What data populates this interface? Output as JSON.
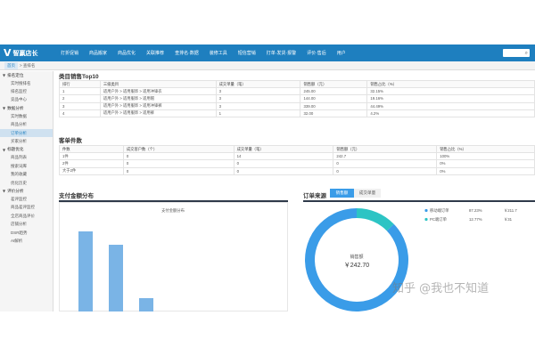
{
  "colors": {
    "topbar": "#1e7fbf",
    "bar": "#7ab4e6",
    "donut_main": "#3a9ce8",
    "donut_secondary": "#2cc4c4"
  },
  "header": {
    "logo": "智赢店长",
    "nav": [
      "打折促销",
      "商品搬家",
      "商品优化",
      "关联推荐",
      "查排名·数据",
      "装修工具",
      "短信营销",
      "打单·发货·报警",
      "评价·售后",
      "用户"
    ]
  },
  "breadcrumb": {
    "home": "首页",
    "current": "> 查排名"
  },
  "sidebar": [
    {
      "type": "group",
      "label": "排名定位"
    },
    {
      "type": "item",
      "label": "实时搜排名"
    },
    {
      "type": "item",
      "label": "排名监控"
    },
    {
      "type": "item",
      "label": "竞品中心"
    },
    {
      "type": "group",
      "label": "数据分析"
    },
    {
      "type": "item",
      "label": "实时数据"
    },
    {
      "type": "item",
      "label": "商品分析"
    },
    {
      "type": "item",
      "label": "订单分析",
      "active": true
    },
    {
      "type": "item",
      "label": "买家分析"
    },
    {
      "type": "group",
      "label": "标题优化"
    },
    {
      "type": "item",
      "label": "商品列表"
    },
    {
      "type": "item",
      "label": "搜索词库"
    },
    {
      "type": "item",
      "label": "我的收藏"
    },
    {
      "type": "item",
      "label": "优化历史"
    },
    {
      "type": "group",
      "label": "评价分析"
    },
    {
      "type": "item",
      "label": "差评监控"
    },
    {
      "type": "item",
      "label": "商品差评监控"
    },
    {
      "type": "item",
      "label": "全店商品评价"
    },
    {
      "type": "item",
      "label": "店铺分析"
    },
    {
      "type": "item",
      "label": "DSR趋势"
    },
    {
      "type": "item",
      "label": "AI解析"
    }
  ],
  "top10": {
    "title": "类目销售Top10",
    "headers": [
      "排行",
      "三级类目",
      "成交单量（笔）",
      "销售额（元）",
      "销售占比（%）"
    ],
    "rows": [
      [
        "1",
        "适用户外 > 适用服饰 > 适用冲锋衣",
        "3",
        "245.00",
        "32.15%"
      ],
      [
        "2",
        "适用户外 > 适用服饰 > 适用帽",
        "3",
        "144.00",
        "19.16%"
      ],
      [
        "3",
        "适用户外 > 适用服饰 > 适用冲锋裤",
        "3",
        "339.00",
        "44.49%"
      ],
      [
        "4",
        "适用户外 > 适用服饰 > 适用裤",
        "1",
        "32.00",
        "4.2%"
      ]
    ]
  },
  "per_order": {
    "title": "客单件数",
    "headers": [
      "件数",
      "成交客户数（个）",
      "成交单量（笔）",
      "销售额（元）",
      "销售占比（%）"
    ],
    "rows": [
      [
        "1件",
        "0",
        "14",
        "242.7",
        "100%"
      ],
      [
        "2件",
        "0",
        "0",
        "0",
        "0%"
      ],
      [
        "大于2件",
        "0",
        "0",
        "0",
        "0%"
      ]
    ]
  },
  "pay_dist": {
    "title": "支付金额分布"
  },
  "order_source": {
    "title": "订单来源",
    "tabs": [
      "销售额",
      "成交单量"
    ],
    "center_label": "销售额",
    "center_value": "￥242.70",
    "legend": [
      {
        "name": "移动端订单",
        "pct": "87.23%",
        "value": "￥211.7"
      },
      {
        "name": "PC端订单",
        "pct": "12.77%",
        "value": "￥31"
      }
    ]
  },
  "chart_data": [
    {
      "type": "bar",
      "title": "支付金额分布",
      "categories": [
        "",
        "",
        "",
        "",
        ""
      ],
      "values": [
        6,
        5,
        1,
        0,
        0
      ],
      "ylim": [
        0,
        7
      ]
    },
    {
      "type": "pie",
      "labels": [
        "移动端订单",
        "PC端订单"
      ],
      "values": [
        87.23,
        12.77
      ]
    }
  ],
  "watermark": "知乎 @我也不知道"
}
